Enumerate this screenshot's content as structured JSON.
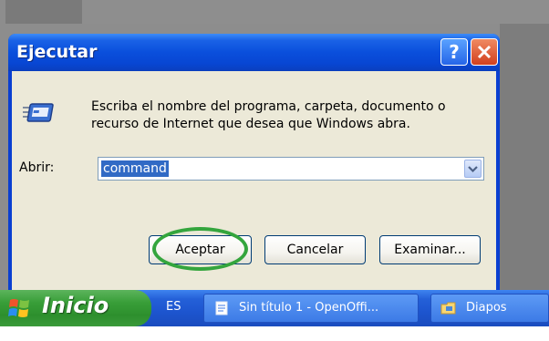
{
  "dialog": {
    "title": "Ejecutar",
    "description": "Escriba el nombre del programa, carpeta, documento o recurso de Internet que desea que Windows abra.",
    "open_label": "Abrir:",
    "command_value": "command",
    "buttons": {
      "accept": "Aceptar",
      "cancel": "Cancelar",
      "browse": "Examinar..."
    },
    "help_glyph": "?",
    "close_glyph": "X"
  },
  "taskbar": {
    "start_label": "Inicio",
    "language": "ES",
    "items": [
      {
        "label": "Sin título 1 - OpenOffi...",
        "icon": "openoffice-icon"
      },
      {
        "label": "Diapos",
        "icon": "folder-icon"
      }
    ]
  },
  "colors": {
    "titlebar_blue": "#0a4fdc",
    "dialog_face": "#ece9d8",
    "start_green": "#389e38",
    "highlight_ellipse": "#34a53d",
    "selection_blue": "#316ac5"
  }
}
